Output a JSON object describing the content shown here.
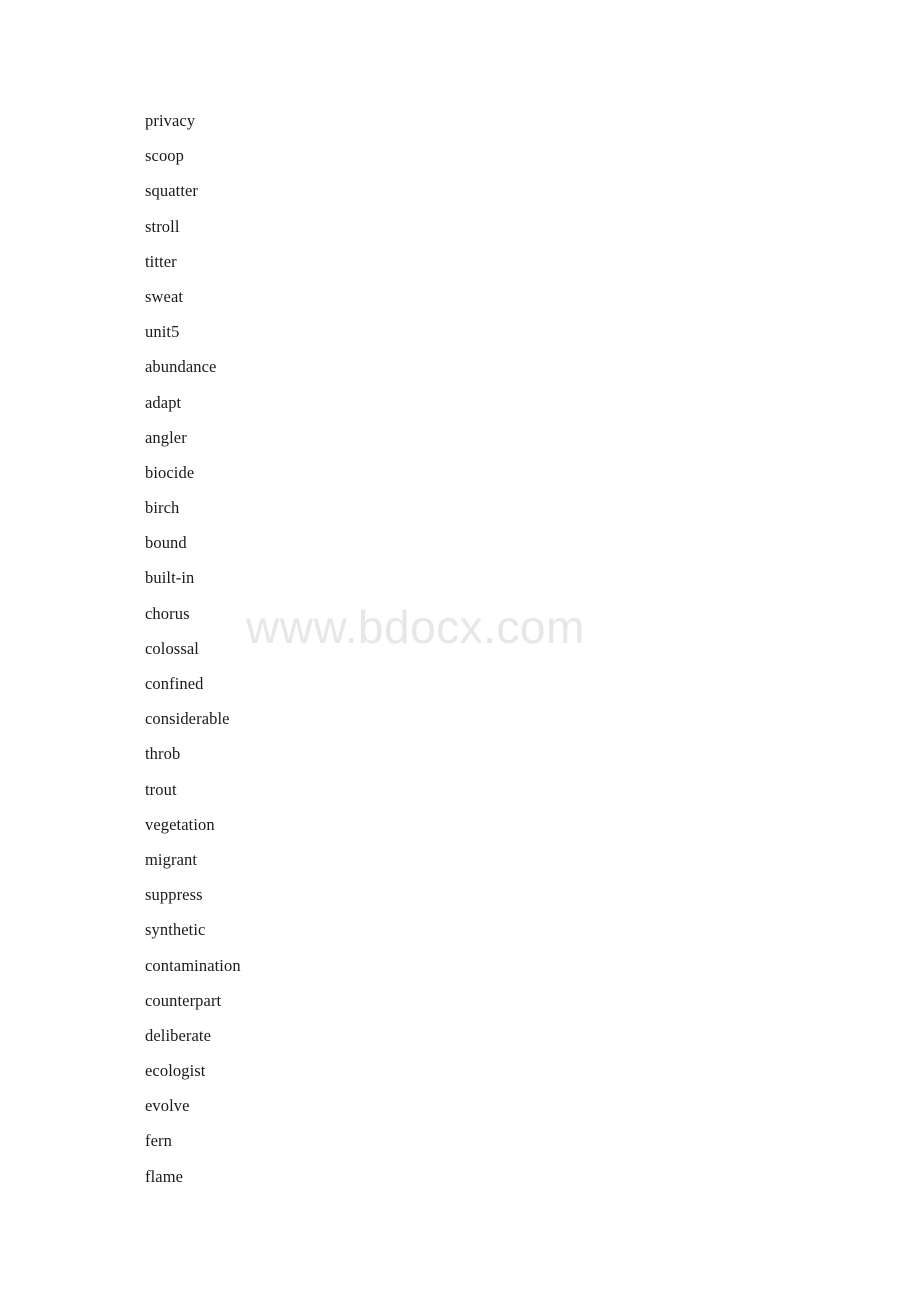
{
  "document": {
    "background_color": "#ffffff",
    "text_color": "#1a1a1a"
  },
  "watermark": {
    "text": "www.bdocx.com",
    "color": "#e7e7e7"
  },
  "word_list": {
    "items": [
      "privacy",
      "scoop",
      "squatter",
      "stroll",
      "titter",
      "sweat",
      "unit5",
      "abundance",
      "adapt",
      "angler",
      "biocide",
      "birch",
      "bound",
      "built-in",
      "chorus",
      "colossal",
      "confined",
      "considerable",
      "throb",
      "trout",
      "vegetation",
      "migrant",
      "suppress",
      "synthetic",
      "contamination",
      "counterpart",
      "deliberate",
      "ecologist",
      "evolve",
      "fern",
      "flame"
    ]
  }
}
